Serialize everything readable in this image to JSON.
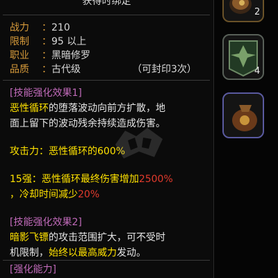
{
  "tooltip": {
    "title": "获得时绑定",
    "stats": [
      {
        "label": "战力",
        "value": "210"
      },
      {
        "label": "限制",
        "value": "95 以上"
      },
      {
        "label": "职业",
        "value": "黑暗修罗"
      },
      {
        "label": "品质",
        "value": "古代级",
        "extra": "（可封印3次）"
      }
    ],
    "effect1": {
      "title": "[技能强化效果1]",
      "line1_skill": "恶性循环",
      "line1_rest": "的堕落波动向前方扩散，地",
      "line2": "面上留下的波动残余持续造成伤害。",
      "atk": "攻击力：恶性循环的600%",
      "enh_prefix": "15强：恶性循环最终伤害增加",
      "enh_value": "2500%",
      "enh_line2_prefix": "，冷却时间减少",
      "enh_line2_value": "20%"
    },
    "effect2": {
      "title": "[技能强化效果2]",
      "line1_skill": "暗影飞镖",
      "line1_rest": "的攻击范围扩大，可不受时",
      "line2_a": "机限制，",
      "line2_b": "始终以最高威力",
      "line2_c": "发动。"
    },
    "effect3": {
      "title": "[强化能力]"
    }
  },
  "slots": [
    {
      "count": "2"
    },
    {
      "count": "4"
    },
    {
      "count": ""
    }
  ],
  "colors": {
    "label": "#d69a3a",
    "purple": "#c06ab9",
    "yellow": "#ffe200",
    "red": "#e23a2c"
  }
}
